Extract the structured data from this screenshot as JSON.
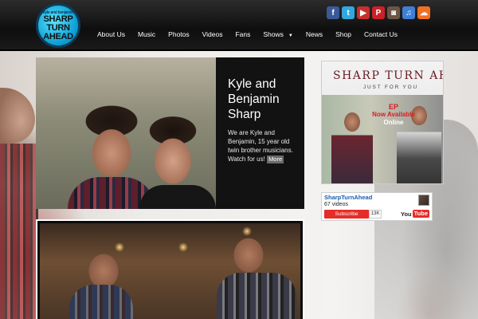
{
  "site": {
    "logo_line1": "SHARP",
    "logo_line2": "TURN",
    "logo_line3": "AHEAD",
    "logo_tagline": "kyle and benjamin"
  },
  "nav": {
    "items": [
      {
        "label": "About Us"
      },
      {
        "label": "Music"
      },
      {
        "label": "Photos"
      },
      {
        "label": "Videos"
      },
      {
        "label": "Fans"
      },
      {
        "label": "Shows",
        "has_dropdown": true
      },
      {
        "label": "News"
      },
      {
        "label": "Shop"
      },
      {
        "label": "Contact Us"
      }
    ]
  },
  "social": [
    {
      "name": "facebook-icon",
      "glyph": "f",
      "color": "#3b5998"
    },
    {
      "name": "twitter-icon",
      "glyph": "t",
      "color": "#2fa9e0"
    },
    {
      "name": "youtube-icon",
      "glyph": "▶",
      "color": "#c4302b"
    },
    {
      "name": "pinterest-icon",
      "glyph": "P",
      "color": "#cb2027"
    },
    {
      "name": "instagram-icon",
      "glyph": "◙",
      "color": "#6d5545"
    },
    {
      "name": "itunes-icon",
      "glyph": "♫",
      "color": "#3f7fd6"
    },
    {
      "name": "soundcloud-icon",
      "glyph": "☁",
      "color": "#f26f23"
    }
  ],
  "hero": {
    "title": "Kyle and Benjamin Sharp",
    "description": "We are Kyle and Benjamin, 15 year old twin brother musicians. Watch for us!",
    "more_label": "More"
  },
  "ep": {
    "title": "SHARP TURN AHEAD",
    "subtitle": "JUST FOR YOU",
    "label_line1": "EP",
    "label_line2": "Now Available",
    "label_line3": "Online"
  },
  "youtube": {
    "channel": "SharpTurnAhead",
    "videos": "67 videos",
    "subscribe_label": "Subscribe",
    "subscriber_count": "13K",
    "logo_you": "You",
    "logo_tube": "Tube"
  }
}
